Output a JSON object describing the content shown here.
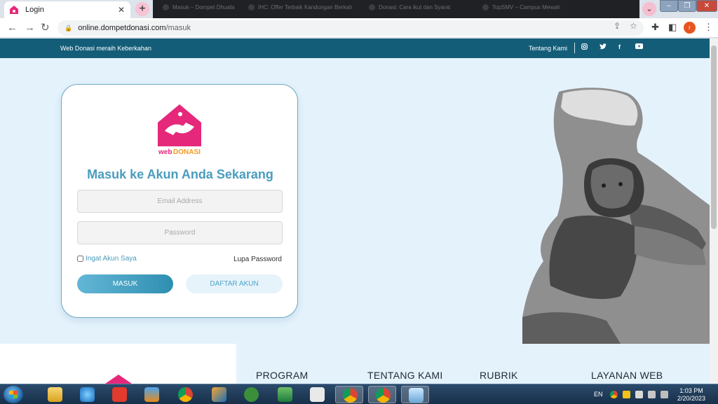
{
  "browser": {
    "tab_title": "Login",
    "background_tabs": [
      "Masuk – Dompet Dhuafa",
      "IHC: Offer Terbaik Kandungan Berkah",
      "Donasi: Cara ikut dan Syarat",
      "TopSMV – Campus Mewah"
    ],
    "url_host": "online.dompetdonasi.com",
    "url_path": "/masuk",
    "profile_initial": "r"
  },
  "site": {
    "tagline": "Web Donasi meraih Keberkahan",
    "top_link": "Tentang Kami",
    "social": [
      "instagram-icon",
      "twitter-icon",
      "facebook-icon",
      "youtube-icon"
    ]
  },
  "login": {
    "logo_text_web": "web",
    "logo_text_brand": "DONASI",
    "title": "Masuk ke Akun Anda Sekarang",
    "email_placeholder": "Email Address",
    "password_placeholder": "Password",
    "remember_label": "Ingat Akun Saya",
    "forgot_label": "Lupa Password",
    "login_button": "MASUK",
    "register_button": "DAFTAR AKUN"
  },
  "footer": {
    "headings": [
      "PROGRAM",
      "TENTANG KAMI",
      "RUBRIK",
      "LAYANAN WEB"
    ]
  },
  "taskbar": {
    "language": "EN",
    "time": "1:03 PM",
    "date": "2/20/2023"
  },
  "colors": {
    "header_bar": "#145d79",
    "accent": "#4a9cbd",
    "brand_pink": "#e5287a",
    "page_bg": "#e4f2fc"
  }
}
